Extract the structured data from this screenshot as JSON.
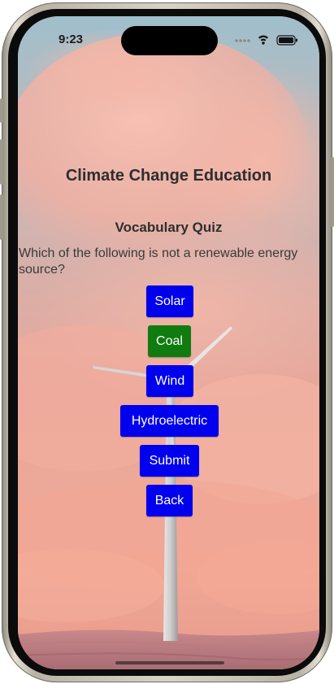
{
  "status_bar": {
    "time": "9:23",
    "icons": [
      "signal-dots-icon",
      "wifi-icon",
      "battery-icon"
    ]
  },
  "page": {
    "title": "Climate Change Education",
    "quiz_title": "Vocabulary Quiz",
    "question": "Which of the following is not a renewable energy source?"
  },
  "answers": [
    {
      "label": "Solar",
      "selected": false
    },
    {
      "label": "Coal",
      "selected": true
    },
    {
      "label": "Wind",
      "selected": false
    },
    {
      "label": "Hydroelectric",
      "selected": false
    }
  ],
  "actions": {
    "submit_label": "Submit",
    "back_label": "Back"
  },
  "colors": {
    "button_default": "#0000ee",
    "button_selected": "#107c10",
    "button_text": "#ffffff",
    "heading_text": "#2e2e2e"
  }
}
